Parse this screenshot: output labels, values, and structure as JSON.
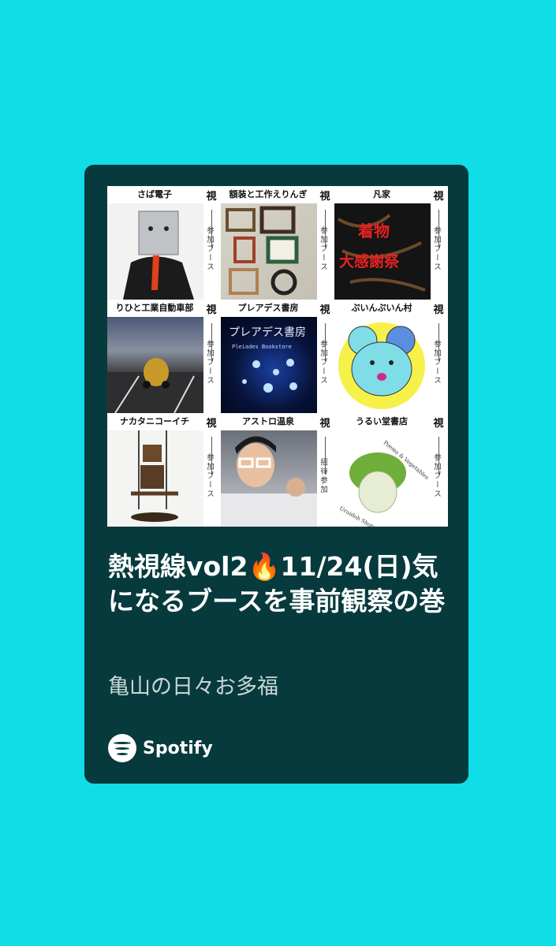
{
  "grid": [
    {
      "label": "さば電子",
      "side": "参加ブース"
    },
    {
      "label": "額装と工作えりんぎ",
      "side": "参加ブース"
    },
    {
      "label": "凡家",
      "side": "参加ブース"
    },
    {
      "label": "りひと工業自動車部",
      "side": "参加ブース"
    },
    {
      "label": "プレアデス書房",
      "side": "参加ブース"
    },
    {
      "label": "ぷいんぷいん村",
      "side": "参加ブース"
    },
    {
      "label": "ナカタニコーイチ",
      "side": "参加ブース"
    },
    {
      "label": "アストロ温泉",
      "side": "招待参加"
    },
    {
      "label": "うるい堂書店",
      "side": "参加ブース"
    }
  ],
  "brand_mark": "視",
  "tile_text": {
    "kimono_line1": "着物",
    "kimono_line2": "大感謝祭",
    "pleiades_title": "プレアデス書房",
    "pleiades_sub": "Pleiades Bookstore",
    "urui_sub": "Uruidoh Shoten",
    "urui_arc": "Poems & Vegetables"
  },
  "episode": {
    "title": "熱視線vol2🔥11/24(日)気になるブースを事前観察の巻",
    "show": "亀山の日々お多福"
  },
  "footer": {
    "brand": "Spotify"
  },
  "colors": {
    "background": "#10dde8",
    "card": "#073a3d",
    "text": "#ffffff"
  }
}
